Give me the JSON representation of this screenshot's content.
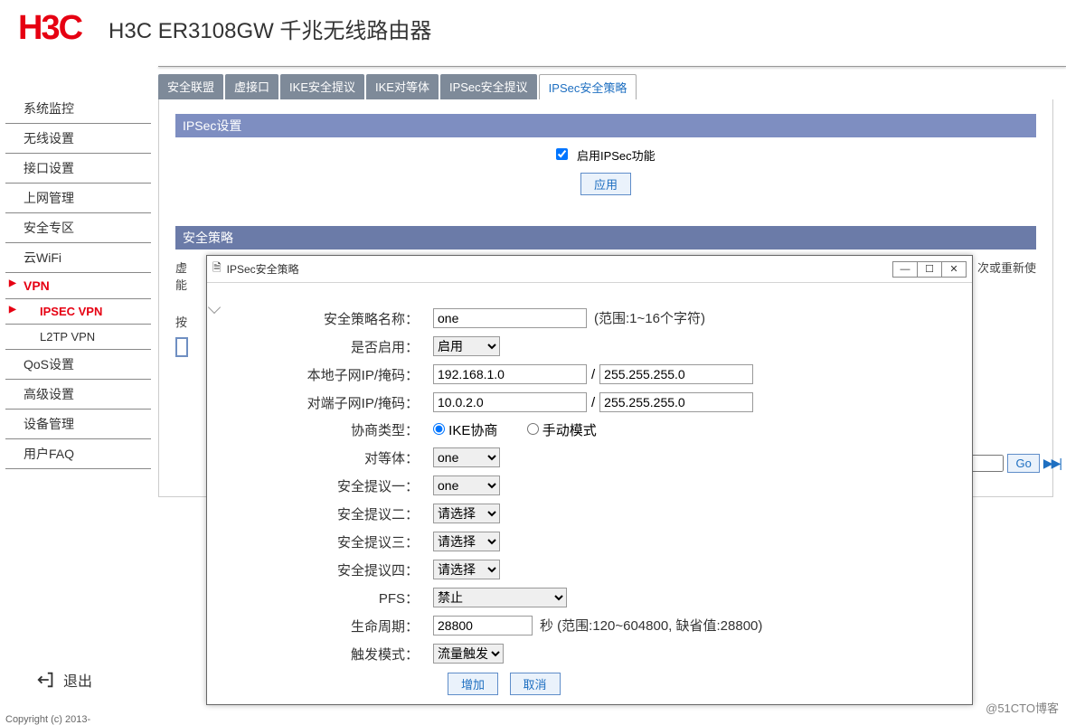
{
  "brand": "H3C",
  "product_title": "H3C ER3108GW 千兆无线路由器",
  "sidebar": {
    "items": [
      {
        "label": "系统监控"
      },
      {
        "label": "无线设置"
      },
      {
        "label": "接口设置"
      },
      {
        "label": "上网管理"
      },
      {
        "label": "安全专区"
      },
      {
        "label": "云WiFi"
      },
      {
        "label": "VPN",
        "active": true
      },
      {
        "label": "IPSEC VPN",
        "sub": true,
        "active": true
      },
      {
        "label": "L2TP VPN",
        "sub": true
      },
      {
        "label": "QoS设置"
      },
      {
        "label": "高级设置"
      },
      {
        "label": "设备管理"
      },
      {
        "label": "用户FAQ"
      }
    ],
    "logout": "退出"
  },
  "tabs": [
    "安全联盟",
    "虚接口",
    "IKE安全提议",
    "IKE对等体",
    "IPSec安全提议",
    "IPSec安全策略"
  ],
  "active_tab": 5,
  "section1_title": "IPSec设置",
  "enable_label": "启用IPSec功能",
  "apply_btn": "应用",
  "section2_title": "安全策略",
  "hint_line1_a": "虚",
  "hint_line1_b": "次或重新使",
  "hint_line2": "能",
  "search_prefix": "按",
  "go_btn": "Go",
  "dialog": {
    "title": "IPSec安全策略",
    "labels": {
      "name": "安全策略名称：",
      "enable": "是否启用：",
      "local": "本地子网IP/掩码：",
      "remote": "对端子网IP/掩码：",
      "nego": "协商类型：",
      "peer": "对等体：",
      "prop1": "安全提议一：",
      "prop2": "安全提议二：",
      "prop3": "安全提议三：",
      "prop4": "安全提议四：",
      "pfs": "PFS：",
      "life": "生命周期：",
      "trigger": "触发模式："
    },
    "values": {
      "name": "one",
      "name_note": "(范围:1~16个字符)",
      "enable": "启用",
      "local_ip": "192.168.1.0",
      "local_mask": "255.255.255.0",
      "remote_ip": "10.0.2.0",
      "remote_mask": "255.255.255.0",
      "nego_ike": "IKE协商",
      "nego_manual": "手动模式",
      "peer": "one",
      "prop1": "one",
      "prop_none": "请选择",
      "pfs": "禁止",
      "life": "28800",
      "life_note": "秒 (范围:120~604800, 缺省值:28800)",
      "trigger": "流量触发"
    },
    "add_btn": "增加",
    "cancel_btn": "取消"
  },
  "copyright": "Copyright (c) 2013-",
  "watermark": "@51CTO博客"
}
